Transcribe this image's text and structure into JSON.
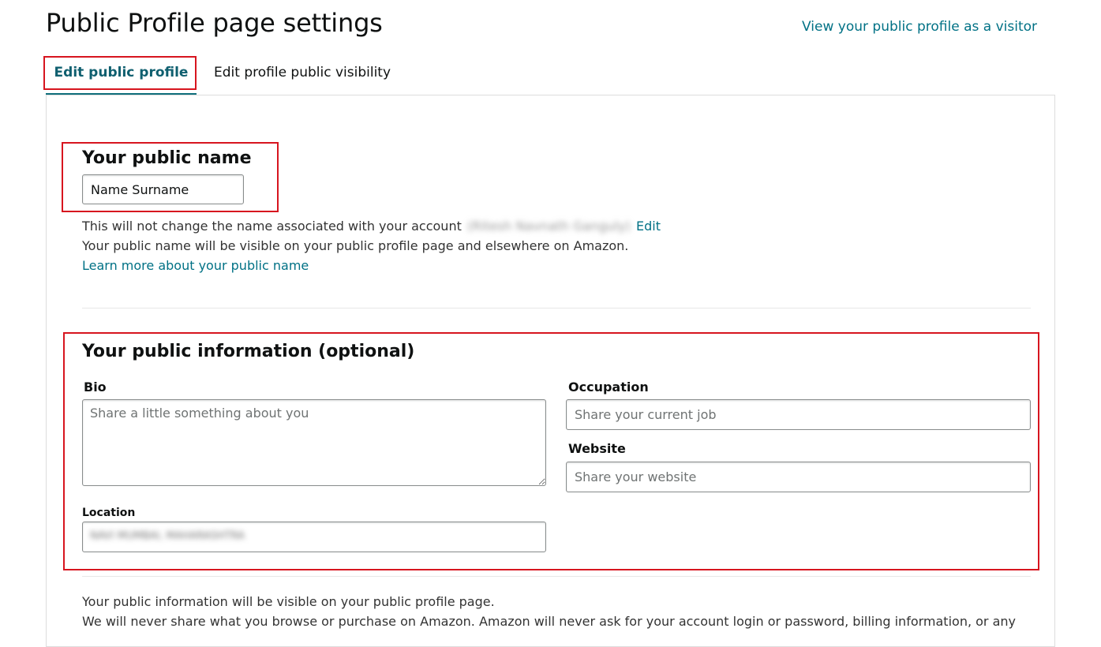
{
  "header": {
    "title": "Public Profile page settings",
    "visitor_link": "View your public profile as a visitor"
  },
  "tabs": [
    {
      "label": "Edit public profile",
      "active": true
    },
    {
      "label": "Edit profile public visibility",
      "active": false
    }
  ],
  "public_name": {
    "heading": "Your public name",
    "value": "Name Surname",
    "account_note": "This will not change the name associated with your account",
    "account_name_redacted": "(Ritesh Navnath Ganguly)",
    "edit_link": "Edit",
    "visibility_note": "Your public name will be visible on your public profile page and elsewhere on Amazon.",
    "learn_more_link": "Learn more about your public name"
  },
  "public_info": {
    "heading": "Your public information (optional)",
    "bio": {
      "label": "Bio",
      "placeholder": "Share a little something about you"
    },
    "occupation": {
      "label": "Occupation",
      "placeholder": "Share your current job"
    },
    "website": {
      "label": "Website",
      "placeholder": "Share your website"
    },
    "location": {
      "label": "Location",
      "value_redacted": "NAVI MUMBAI, MAHARASHTRA"
    }
  },
  "footer": {
    "visibility_note": "Your public information will be visible on your public profile page.",
    "privacy_note": "We will never share what you browse or purchase on Amazon. Amazon will never ask for your account login or password, billing information, or any"
  },
  "colors": {
    "link": "#007185",
    "active_tab": "#0f6f7c",
    "highlight": "#d7151f",
    "input_border": "#888c8c"
  }
}
